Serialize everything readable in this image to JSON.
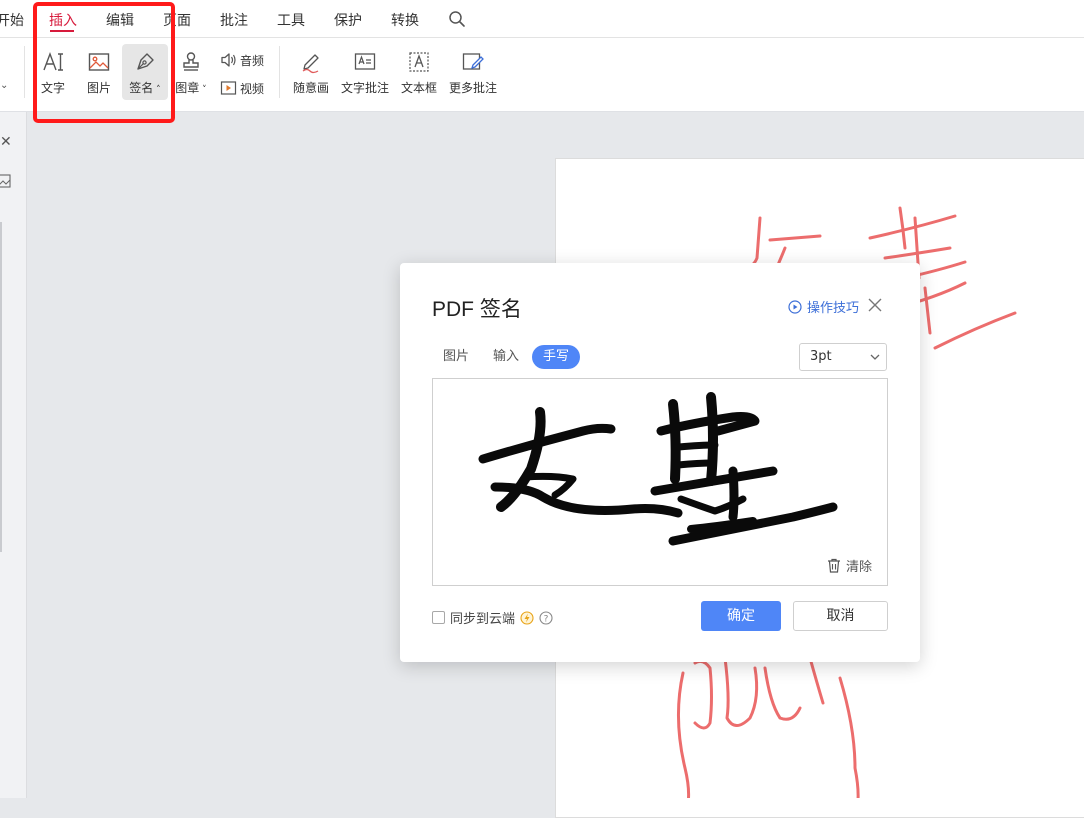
{
  "menu": {
    "items": [
      "开始",
      "插入",
      "编辑",
      "页面",
      "批注",
      "工具",
      "保护",
      "转换"
    ],
    "active_index": 1,
    "accent_color": "#d71b3c"
  },
  "ribbon": {
    "text_label": "文字",
    "image_label": "图片",
    "signature_label": "签名",
    "stamp_label": "图章",
    "audio_label": "音频",
    "video_label": "视频",
    "freehand_label": "随意画",
    "text_annotation_label": "文字批注",
    "textbox_label": "文本框",
    "more_annotations_label": "更多批注"
  },
  "dialog": {
    "title": "PDF 签名",
    "tips_label": "操作技巧",
    "tabs": [
      "图片",
      "输入",
      "手写"
    ],
    "active_tab": "手写",
    "pen_size": "3pt",
    "signature_text": "友基",
    "clear_label": "清除",
    "sync_label": "同步到云端",
    "sync_checked": false,
    "ok_label": "确定",
    "cancel_label": "取消",
    "accent_color": "#4f86f7"
  },
  "highlight_color": "#ff1a1a",
  "doc_ink_color": "#ec6d6d"
}
